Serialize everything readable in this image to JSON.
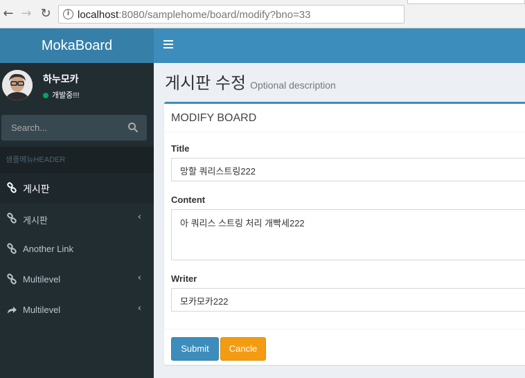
{
  "browser": {
    "url_host": "localhost",
    "url_rest": ":8080/samplehome/board/modify?bno=33"
  },
  "sidebar": {
    "brand": "MokaBoard",
    "user": {
      "name": "하누모카",
      "status": "개발중!!!"
    },
    "search_placeholder": "Search...",
    "header": "샘플메뉴HEADER",
    "items": [
      {
        "label": "게시판",
        "icon": "link-icon",
        "active": true
      },
      {
        "label": "게시판",
        "icon": "link-icon",
        "has_submenu": true
      },
      {
        "label": "Another Link",
        "icon": "link-icon"
      },
      {
        "label": "Multilevel",
        "icon": "link-icon",
        "has_submenu": true
      },
      {
        "label": "Multilevel",
        "icon": "share-icon",
        "has_submenu": true
      }
    ]
  },
  "page": {
    "title": "게시판 수정",
    "description": "Optional description"
  },
  "form": {
    "box_title": "MODIFY BOARD",
    "title_label": "Title",
    "title_value": "망할 쿼리스트링222",
    "content_label": "Content",
    "content_value": "아 쿼리스 스트링 처리 개빡세222",
    "writer_label": "Writer",
    "writer_value": "모카모카222",
    "submit_label": "Submit",
    "cancel_label": "Cancle"
  },
  "colors": {
    "accent": "#3c8dbc",
    "logo_bg": "#367fa9",
    "sidebar_bg": "#222d32",
    "warning": "#f39c12",
    "online": "#00a65a"
  }
}
